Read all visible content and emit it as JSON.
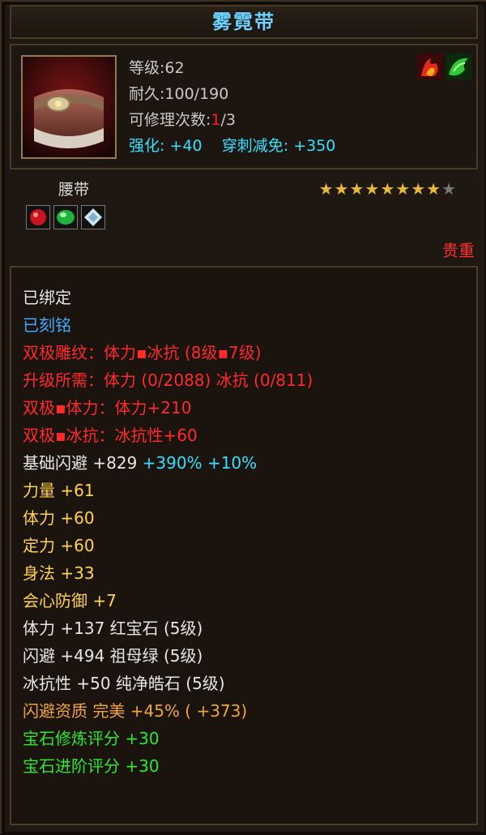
{
  "item": {
    "name": "雾霓带",
    "level_line": "等级:62",
    "durability_label": "耐久:",
    "durability_value": "100/190",
    "repair_label": "可修理次数:",
    "repair_used": "1",
    "repair_total": "/3",
    "enhance_label": "强化:",
    "enhance_value": "+40",
    "pierce_label": "穿刺减免:",
    "pierce_value": "+350",
    "type": "腰带",
    "stars_total": 9,
    "stars_filled": 8,
    "rarity": "贵重",
    "gem_icons": [
      "ruby-gem-icon",
      "emerald-gem-icon",
      "diamond-gem-icon"
    ],
    "element_icons": [
      "fire-element-icon",
      "wood-element-icon"
    ]
  },
  "colors": {
    "title": "#6fd3ff",
    "red": "#ff2a2a",
    "blue": "#3aaaff",
    "orange": "#f0a33a",
    "yellow": "#ffd34a",
    "cyan": "#32e0ff",
    "green": "#2ee82e",
    "star": "#e3b83b"
  },
  "attributes": [
    {
      "parts": [
        {
          "text": "已绑定",
          "color": "white"
        }
      ]
    },
    {
      "parts": [
        {
          "text": "已刻铭",
          "color": "blue"
        }
      ]
    },
    {
      "parts": [
        {
          "text": "双极雕纹：体力▪冰抗 (8级▪7级)",
          "color": "red"
        }
      ]
    },
    {
      "parts": [
        {
          "text": "升级所需：体力 (0/2088)  冰抗 (0/811)",
          "color": "red"
        }
      ]
    },
    {
      "parts": [
        {
          "text": "双极▪体力：体力+210",
          "color": "red"
        }
      ]
    },
    {
      "parts": [
        {
          "text": "双极▪冰抗：冰抗性+60",
          "color": "red"
        }
      ]
    },
    {
      "parts": [
        {
          "text": "基础闪避 +829 ",
          "color": "white"
        },
        {
          "text": "+390% +10%",
          "color": "cyan"
        }
      ]
    },
    {
      "parts": [
        {
          "text": "力量 +61",
          "color": "yellow"
        }
      ]
    },
    {
      "parts": [
        {
          "text": "体力 +60",
          "color": "yellow"
        }
      ]
    },
    {
      "parts": [
        {
          "text": "定力 +60",
          "color": "yellow"
        }
      ]
    },
    {
      "parts": [
        {
          "text": "身法 +33",
          "color": "yellow"
        }
      ]
    },
    {
      "parts": [
        {
          "text": "会心防御 +7",
          "color": "yellow"
        }
      ]
    },
    {
      "parts": [
        {
          "text": "体力 +137 红宝石 (5级)",
          "color": "white"
        }
      ]
    },
    {
      "parts": [
        {
          "text": "闪避 +494 祖母绿 (5级)",
          "color": "white"
        }
      ]
    },
    {
      "parts": [
        {
          "text": "冰抗性 +50 纯净皓石 (5级)",
          "color": "white"
        }
      ]
    },
    {
      "parts": [
        {
          "text": "闪避资质  完美 +45% ( +373)",
          "color": "orange"
        }
      ]
    },
    {
      "parts": [
        {
          "text": "宝石修炼评分 +30",
          "color": "green"
        }
      ]
    },
    {
      "parts": [
        {
          "text": "宝石进阶评分 +30",
          "color": "green"
        }
      ]
    }
  ]
}
